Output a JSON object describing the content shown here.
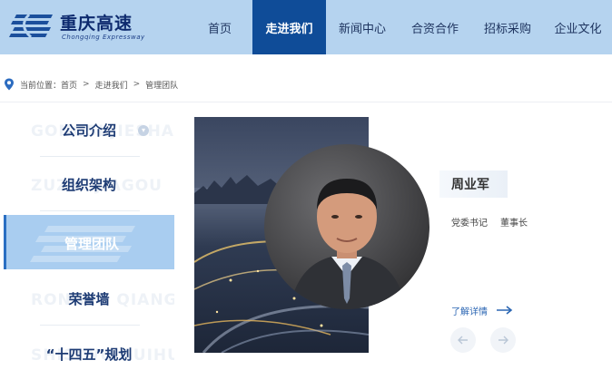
{
  "header": {
    "logo_title": "重庆高速",
    "logo_subtitle": "Chongqing Expressway",
    "nav": [
      {
        "label": "首页",
        "active": false
      },
      {
        "label": "走进我们",
        "active": true
      },
      {
        "label": "新闻中心",
        "active": false
      },
      {
        "label": "合资合作",
        "active": false
      },
      {
        "label": "招标采购",
        "active": false
      },
      {
        "label": "企业文化",
        "active": false
      }
    ]
  },
  "breadcrumb": {
    "prefix": "当前位置：",
    "items": [
      "首页",
      "走进我们",
      "管理团队"
    ],
    "separator": ">"
  },
  "sidebar": {
    "items": [
      {
        "label": "公司介绍",
        "ghost": "GONGSI JIESHAO",
        "active": false,
        "has_toggle": true
      },
      {
        "label": "组织架构",
        "ghost": "ZUZHI JIAGOU",
        "active": false,
        "has_toggle": false
      },
      {
        "label": "管理团队",
        "ghost": "",
        "active": true,
        "has_toggle": false
      },
      {
        "label": "荣誉墙",
        "ghost": "RONGYU QIANG",
        "active": false,
        "has_toggle": false
      },
      {
        "label": "“十四五”规划",
        "ghost": "SHISIWU GUIHUA",
        "active": false,
        "has_toggle": false
      }
    ]
  },
  "profile": {
    "name": "周业军",
    "titles": [
      "党委书记",
      "董事长"
    ],
    "more_label": "了解详情"
  },
  "colors": {
    "header_bg": "#b5d3ef",
    "nav_active": "#0f4c98",
    "sidebar_active": "#a9cdf0",
    "link": "#2b66b3"
  },
  "icons": {
    "location": "location-pin-icon",
    "arrow": "arrow-right-icon",
    "prev": "arrow-left-icon",
    "next": "arrow-right-icon"
  }
}
